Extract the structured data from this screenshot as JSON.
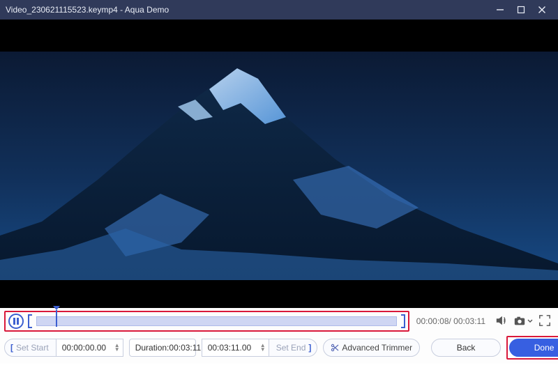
{
  "title": "Video_230621115523.keymp4   -   Aqua Demo",
  "playback": {
    "current": "00:00:08",
    "total": "00:03:11",
    "display": "00:00:08/ 00:03:11"
  },
  "trim": {
    "set_start_label": "Set Start",
    "set_end_label": "Set End",
    "start_value": "00:00:00.00",
    "end_value": "00:03:11.00",
    "duration_label": "Duration:",
    "duration_value": "00:03:11"
  },
  "buttons": {
    "advanced_trimmer": "Advanced Trimmer",
    "back": "Back",
    "done": "Done"
  },
  "icons": {
    "play_state": "pause",
    "volume": "volume-icon",
    "snapshot": "camera-icon",
    "fullscreen": "fullscreen-icon"
  },
  "colors": {
    "accent": "#375fe1",
    "highlight_box": "#d9183a",
    "titlebar": "#303a5a"
  }
}
